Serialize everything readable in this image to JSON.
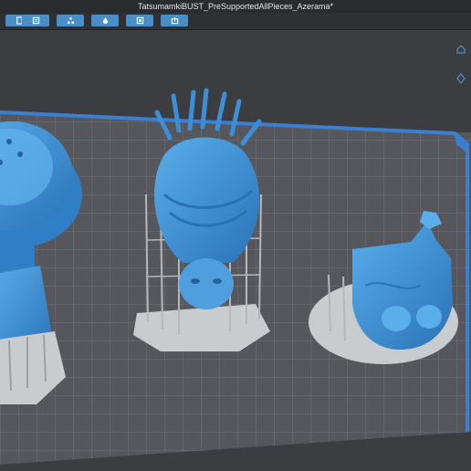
{
  "window": {
    "title": "TatsumamkiBUST_PreSupportedAllPieces_Azerama*"
  },
  "toolbar": {
    "buttons": [
      {
        "name": "file-button",
        "icon": "file-icon"
      },
      {
        "name": "layers-button",
        "icon": "layers-icon"
      },
      {
        "name": "supports-button",
        "icon": "supports-icon"
      },
      {
        "name": "material-button",
        "icon": "drop-icon"
      },
      {
        "name": "preview-button",
        "icon": "preview-icon"
      },
      {
        "name": "export-button",
        "icon": "export-icon"
      }
    ]
  },
  "viewport": {
    "background_color": "#3c3d41",
    "plate_color": "#55575c",
    "grid_color": "#6f7176",
    "border_color": "#3b7fd1",
    "model_color": "#3c8fd6",
    "support_color": "#b5b8bb",
    "raft_color": "#c9ccce",
    "side_icons": [
      "home-icon",
      "rotate-view-icon"
    ]
  }
}
